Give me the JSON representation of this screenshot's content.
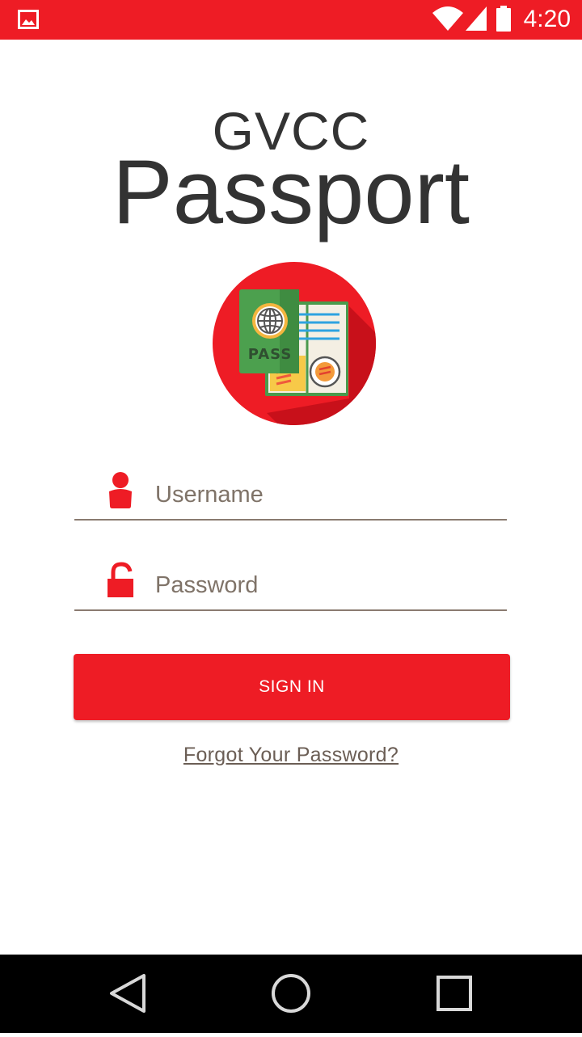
{
  "status_bar": {
    "time": "4:20",
    "icons": [
      "image-notification-icon",
      "wifi-icon",
      "cell-signal-icon",
      "battery-icon"
    ],
    "background_color": "#ee1c25"
  },
  "header": {
    "title_small": "GVCC",
    "title_big": "Passport"
  },
  "logo": {
    "icon": "passport-icon",
    "label": "PASS",
    "circle_color": "#ee1c25"
  },
  "form": {
    "username": {
      "placeholder": "Username",
      "value": "",
      "icon": "user-icon"
    },
    "password": {
      "placeholder": "Password",
      "value": "",
      "icon": "unlock-icon"
    },
    "signin_label": "SIGN IN",
    "forgot_label": "Forgot Your Password?"
  },
  "nav_bar": {
    "icons": [
      "back-icon",
      "home-icon",
      "recent-apps-icon"
    ]
  },
  "colors": {
    "accent": "#ee1c25",
    "text_dark": "#333333",
    "underline": "#8a7b70"
  }
}
